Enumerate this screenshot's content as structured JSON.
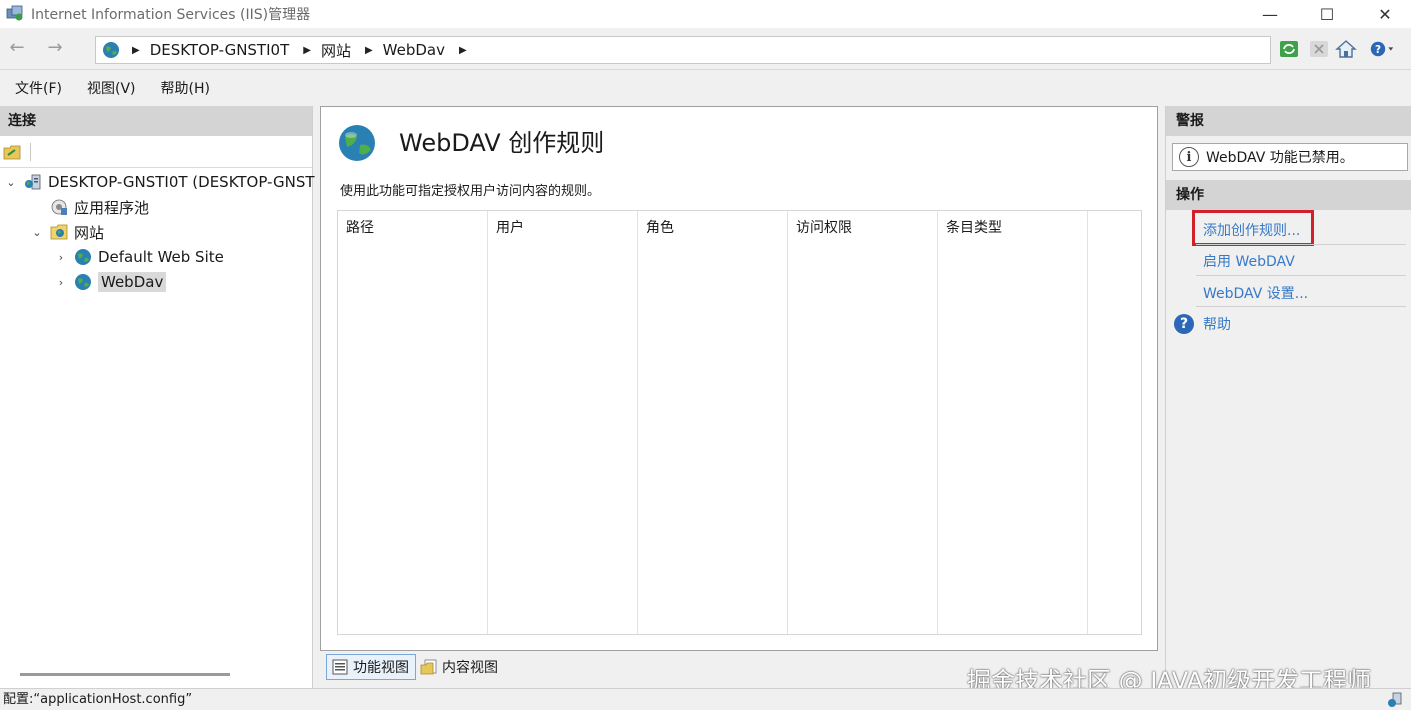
{
  "window": {
    "title": "Internet Information Services (IIS)管理器",
    "min": "—",
    "max": "☐",
    "close": "✕"
  },
  "nav": {
    "back": "←",
    "forward": "→"
  },
  "address": {
    "segments": [
      "DESKTOP-GNSTI0T",
      "网站",
      "WebDav"
    ],
    "separator": "▶"
  },
  "menu": [
    "文件(F)",
    "视图(V)",
    "帮助(H)"
  ],
  "left_panel": {
    "header": "连接",
    "tree": [
      {
        "label": "DESKTOP-GNSTI0T (DESKTOP-GNST",
        "icon": "server-icon",
        "twisty": "⌄"
      },
      {
        "label": "应用程序池",
        "icon": "app-pool-icon",
        "twisty": ""
      },
      {
        "label": "网站",
        "icon": "sites-folder-icon",
        "twisty": "⌄"
      },
      {
        "label": "Default Web Site",
        "icon": "globe-icon",
        "twisty": "›"
      },
      {
        "label": "WebDav",
        "icon": "globe-icon",
        "twisty": "›"
      }
    ]
  },
  "center": {
    "title": "WebDAV 创作规则",
    "description": "使用此功能可指定授权用户访问内容的规则。",
    "columns": [
      "路径",
      "用户",
      "角色",
      "访问权限",
      "条目类型"
    ]
  },
  "view_tabs": [
    "功能视图",
    "内容视图"
  ],
  "right_panel": {
    "alerts_header": "警报",
    "alert_text": "WebDAV 功能已禁用。",
    "info_glyph": "i",
    "actions_header": "操作",
    "actions": [
      "添加创作规则...",
      "启用 WebDAV",
      "WebDAV 设置..."
    ],
    "help_label": "帮助",
    "help_glyph": "?"
  },
  "status": {
    "text": "配置:“applicationHost.config”"
  },
  "watermark": "掘金技术社区 @ JAVA初级开发工程师",
  "colors": {
    "link": "#3879c8",
    "highlight": "#d1202a",
    "panel_header": "#d4d4d4"
  }
}
